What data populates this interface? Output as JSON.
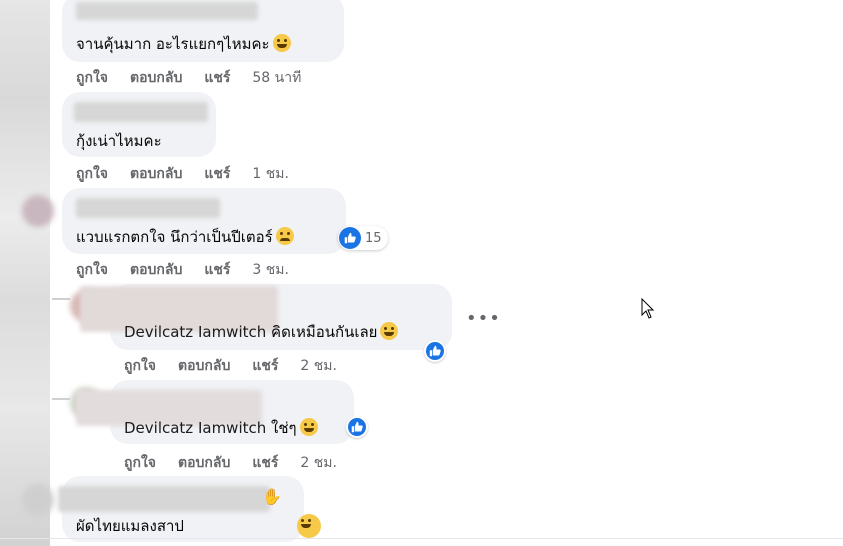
{
  "comments": [
    {
      "text": "จานคุ้นมาก อะไรแยกๆไหมคะ",
      "emoji": "grinning-sweat-emoji",
      "actions": {
        "like": "ถูกใจ",
        "reply": "ตอบกลับ",
        "share": "แชร์",
        "time": "58 นาที"
      }
    },
    {
      "text": "กุ้งเน่าไหมคะ",
      "actions": {
        "like": "ถูกใจ",
        "reply": "ตอบกลับ",
        "share": "แชร์",
        "time": "1 ชม."
      }
    },
    {
      "text": "แวบแรกตกใจ นึกว่าเป็นปีเตอร์",
      "emoji": "sad-emoji",
      "reaction_count": "15",
      "actions": {
        "like": "ถูกใจ",
        "reply": "ตอบกลับ",
        "share": "แชร์",
        "time": "3 ชม."
      }
    }
  ],
  "replies": [
    {
      "mention": "Devilcatz Iamwitch",
      "text": "คิดเหมือนกันเลย",
      "emoji": "laughing-emoji",
      "actions": {
        "like": "ถูกใจ",
        "reply": "ตอบกลับ",
        "share": "แชร์",
        "time": "2 ชม."
      }
    },
    {
      "mention": "Devilcatz Iamwitch",
      "text": "ใช่ๆ",
      "emoji": "grinning-sweat-emoji",
      "actions": {
        "like": "ถูกใจ",
        "reply": "ตอบกลับ",
        "share": "แชร์",
        "time": "2 ชม."
      }
    }
  ],
  "last_comment": {
    "text": "ผัดไทยแมลงสาป",
    "emoji": "laughing-emoji"
  },
  "more_options": "•••",
  "colors": {
    "bubble": "#f0f2f5",
    "action_text": "#65676b",
    "like_blue": "#1b74e4"
  }
}
